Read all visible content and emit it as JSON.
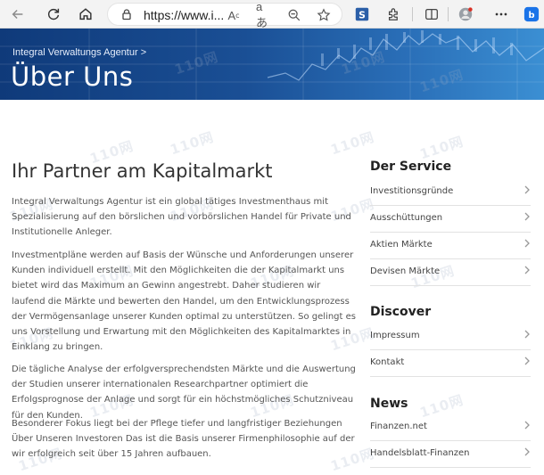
{
  "browser": {
    "url": "https://www.i..."
  },
  "hero": {
    "breadcrumb": "Integral Verwaltungs Agentur >",
    "title": "Über Uns"
  },
  "watermark": "110网",
  "main": {
    "heading": "Ihr Partner am Kapitalmarkt",
    "paragraphs": [
      "Integral Verwaltungs Agentur ist ein global tätiges Investmenthaus mit Spezialisierung auf den börslichen und vorbörslichen Handel für Private und Institutionelle Anleger.",
      "Investmentpläne werden auf Basis der Wünsche und Anforderungen unserer Kunden individuell erstellt. Mit den Möglichkeiten die der Kapitalmarkt uns bietet wird das Maximum an Gewinn angestrebt. Daher studieren wir laufend die Märkte und bewerten den Handel, um den Entwicklungsprozess der Vermögensanlage unserer Kunden optimal zu unterstützen. So gelingt es uns Vorstellung und Erwartung mit den Möglichkeiten des Kapitalmarktes in Einklang zu bringen.",
      "Die tägliche Analyse der erfolgversprechendsten Märkte und die Auswertung der Studien unserer internationalen Researchpartner optimiert die Erfolgsprognose der Anlage und sorgt für ein höchstmögliches Schutzniveau für den Kunden.",
      "Besonderer Fokus liegt bei der Pflege tiefer und langfristiger Beziehungen Über Unseren Investoren Das ist die Basis unserer Firmenphilosophie auf der wir erfolgreich seit über 15 Jahren aufbauen."
    ]
  },
  "sidebar": {
    "service": {
      "heading": "Der Service",
      "items": [
        "Investitionsgründe",
        "Ausschüttungen",
        "Aktien Märkte",
        "Devisen Märkte"
      ]
    },
    "discover": {
      "heading": "Discover",
      "items": [
        "Impressum",
        "Kontakt"
      ]
    },
    "news": {
      "heading": "News",
      "items": [
        "Finanzen.net",
        "Handelsblatt-Finanzen"
      ]
    }
  }
}
